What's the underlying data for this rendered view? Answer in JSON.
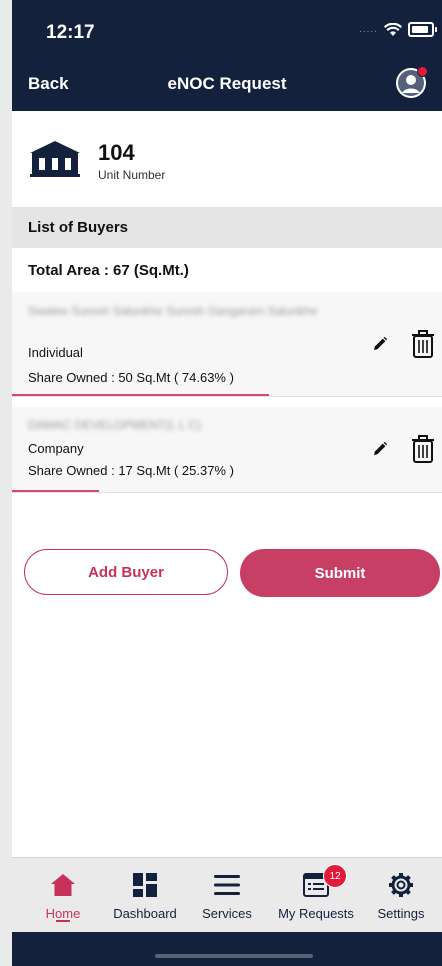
{
  "status": {
    "time": "12:17",
    "signal": "....."
  },
  "header": {
    "back_label": "Back",
    "title": "eNOC Request"
  },
  "unit": {
    "number": "104",
    "label": "Unit Number"
  },
  "buyers_section": {
    "title": "List of Buyers",
    "total_area": "Total Area : 67 (Sq.Mt.)"
  },
  "buyers": [
    {
      "name": "Swatee Suresh Salunkhe Suresh Gangaram Salunkhe",
      "type": "Individual",
      "share": "Share Owned : 50 Sq.Mt  ( 74.63% )",
      "share_percent": 74.63
    },
    {
      "name": "DAMAC DEVELOPMENT(L L C)",
      "type": "Company",
      "share": "Share Owned : 17 Sq.Mt  ( 25.37% )",
      "share_percent": 25.37
    }
  ],
  "actions": {
    "add_label": "Add Buyer",
    "submit_label": "Submit"
  },
  "tabs": [
    {
      "label": "Home",
      "icon": "home-icon"
    },
    {
      "label": "Dashboard",
      "icon": "dashboard-icon"
    },
    {
      "label": "Services",
      "icon": "menu-icon"
    },
    {
      "label": "My Requests",
      "icon": "requests-icon",
      "badge": "12"
    },
    {
      "label": "Settings",
      "icon": "gear-icon"
    }
  ],
  "colors": {
    "navy": "#14213d",
    "accent": "#c83f66",
    "badge": "#e21b3b"
  }
}
